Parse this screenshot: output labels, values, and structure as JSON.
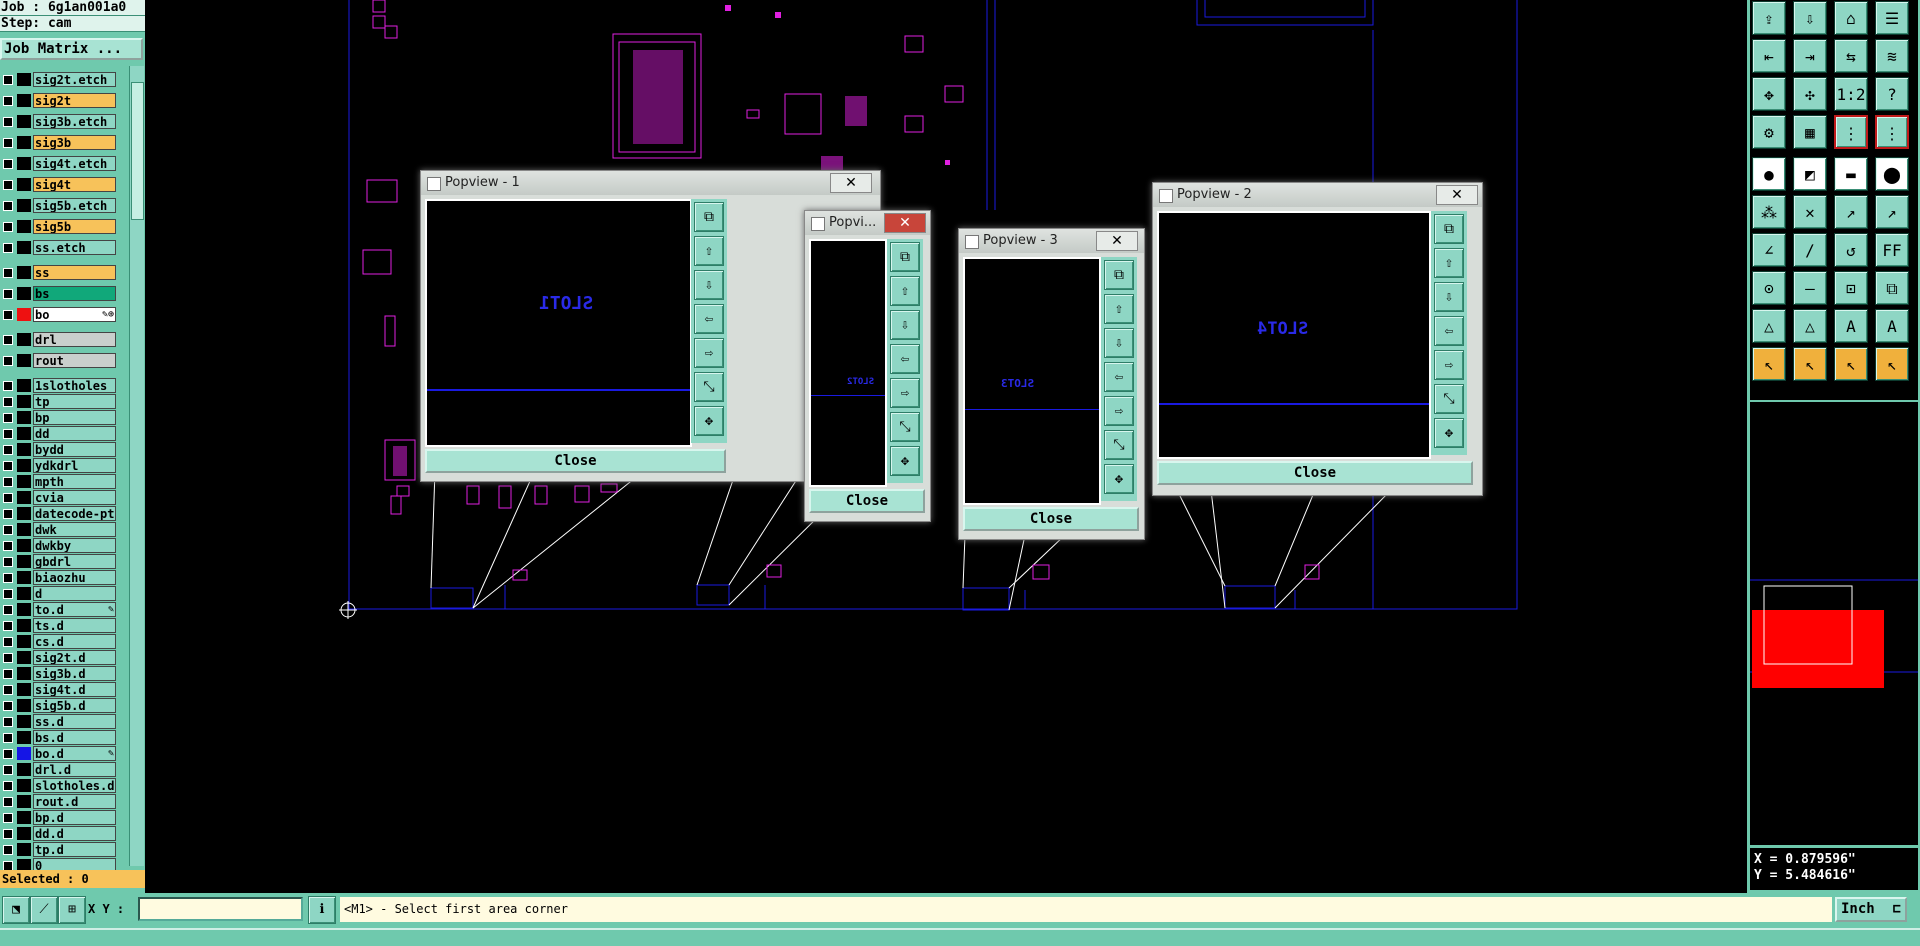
{
  "header": {
    "job": "Job : 6g1an001a0",
    "step": "Step: cam",
    "job_matrix_button": "Job Matrix ..."
  },
  "layers": [
    {
      "name": "sig2t.etch",
      "style": "teal"
    },
    {
      "name": "sig2t",
      "style": "orange"
    },
    {
      "name": "sig3b.etch",
      "style": "teal"
    },
    {
      "name": "sig3b",
      "style": "orange"
    },
    {
      "name": "sig4t.etch",
      "style": "teal"
    },
    {
      "name": "sig4t",
      "style": "orange"
    },
    {
      "name": "sig5b.etch",
      "style": "teal"
    },
    {
      "name": "sig5b",
      "style": "orange"
    },
    {
      "name": "ss.etch",
      "style": "teal"
    },
    {
      "name": "ss",
      "style": "orange"
    },
    {
      "name": "bs",
      "style": "green"
    },
    {
      "name": "bo",
      "style": "white",
      "swatch": "#e11",
      "marker": "✎⊕"
    },
    {
      "name": "drl",
      "style": "grey"
    },
    {
      "name": "rout",
      "style": "grey"
    },
    {
      "name": "1slotholes",
      "style": "teal"
    },
    {
      "name": "tp",
      "style": "teal"
    },
    {
      "name": "bp",
      "style": "teal"
    },
    {
      "name": "dd",
      "style": "teal"
    },
    {
      "name": "bydd",
      "style": "teal"
    },
    {
      "name": "ydkdrl",
      "style": "teal"
    },
    {
      "name": "mpth",
      "style": "teal"
    },
    {
      "name": "cvia",
      "style": "teal"
    },
    {
      "name": "datecode-pth",
      "style": "teal"
    },
    {
      "name": "dwk",
      "style": "teal"
    },
    {
      "name": "dwkby",
      "style": "teal"
    },
    {
      "name": "gbdrl",
      "style": "teal"
    },
    {
      "name": "biaozhu",
      "style": "teal"
    },
    {
      "name": "d",
      "style": "teal"
    },
    {
      "name": "to.d",
      "style": "teal",
      "marker": "✎"
    },
    {
      "name": "ts.d",
      "style": "teal"
    },
    {
      "name": "cs.d",
      "style": "teal"
    },
    {
      "name": "sig2t.d",
      "style": "teal"
    },
    {
      "name": "sig3b.d",
      "style": "teal"
    },
    {
      "name": "sig4t.d",
      "style": "teal"
    },
    {
      "name": "sig5b.d",
      "style": "teal"
    },
    {
      "name": "ss.d",
      "style": "teal"
    },
    {
      "name": "bs.d",
      "style": "teal"
    },
    {
      "name": "bo.d",
      "style": "teal",
      "swatch": "#1515e6",
      "marker": "✎"
    },
    {
      "name": "drl.d",
      "style": "teal"
    },
    {
      "name": "slotholes.d",
      "style": "teal"
    },
    {
      "name": "rout.d",
      "style": "teal"
    },
    {
      "name": "bp.d",
      "style": "teal"
    },
    {
      "name": "dd.d",
      "style": "teal"
    },
    {
      "name": "tp.d",
      "style": "teal"
    },
    {
      "name": "0",
      "style": "teal"
    }
  ],
  "selected": "Selected : 0",
  "popviews": [
    {
      "title": "Popview - 1",
      "slot": "SLOT1",
      "close": "Close"
    },
    {
      "title": "Popvi...",
      "slot": "SLOT2",
      "close": "Close"
    },
    {
      "title": "Popview - 3",
      "slot": "SLOT3",
      "close": "Close"
    },
    {
      "title": "Popview - 2",
      "slot": "SLOT4",
      "close": "Close"
    }
  ],
  "popview_close_glyph": "✕",
  "coords": {
    "x": "X = 0.879596\"",
    "y": "Y = 5.484616\""
  },
  "bottom": {
    "xy_label": "X Y :",
    "xy_value": "",
    "message": "<M1> - Select first area corner",
    "units": "Inch"
  },
  "colors": {
    "panel": "#6fc9ad",
    "layer_active": "#f7c25a",
    "drawing_magenta": "#e020e0",
    "drawing_blue": "#1a1ae0",
    "highlight_red": "#ff0000"
  }
}
